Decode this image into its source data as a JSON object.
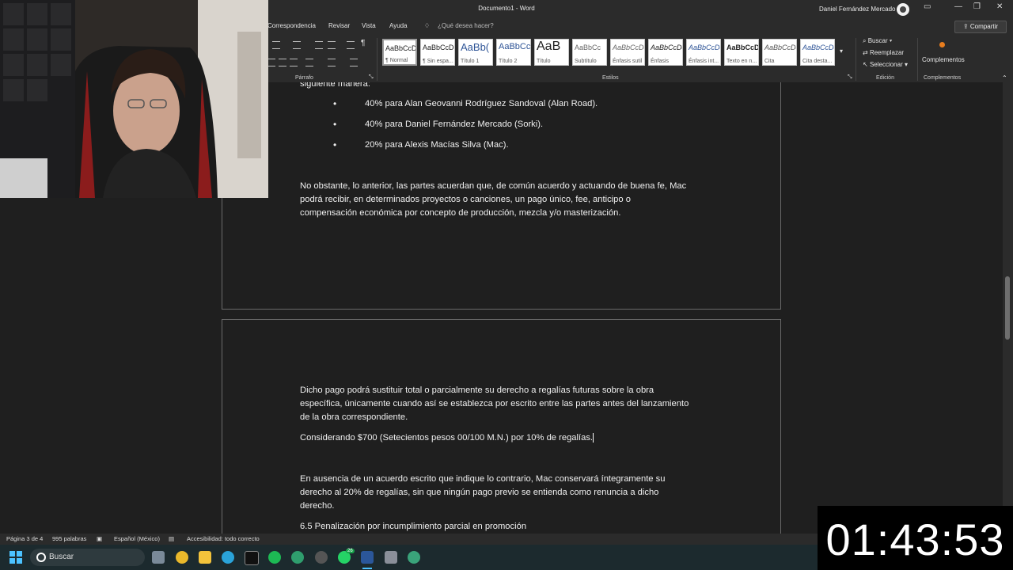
{
  "window": {
    "doc_title": "Documento1 - Word",
    "user_name": "Daniel Fernández Mercado",
    "share_label": "Compartir"
  },
  "tabs": [
    "Correspondencia",
    "Revisar",
    "Vista",
    "Ayuda"
  ],
  "tell_me": "¿Qué desea hacer?",
  "ribbon": {
    "parrafo_label": "Párrafo",
    "estilos_label": "Estilos",
    "edicion_label": "Edición",
    "complementos_group_label": "Complementos",
    "complementos_button": "Complementos",
    "buscar": "Buscar",
    "reemplazar": "Reemplazar",
    "seleccionar": "Seleccionar",
    "styles": [
      {
        "sample": "AaBbCcDc",
        "name": "¶ Normal"
      },
      {
        "sample": "AaBbCcDc",
        "name": "¶ Sin espa..."
      },
      {
        "sample": "AaBb(",
        "name": "Título 1"
      },
      {
        "sample": "AaBbCc",
        "name": "Título 2"
      },
      {
        "sample": "AaB",
        "name": "Título"
      },
      {
        "sample": "AaBbCc",
        "name": "Subtítulo"
      },
      {
        "sample": "AaBbCcDc",
        "name": "Énfasis sutil"
      },
      {
        "sample": "AaBbCcDc",
        "name": "Énfasis"
      },
      {
        "sample": "AaBbCcDc",
        "name": "Énfasis int..."
      },
      {
        "sample": "AaBbCcDc",
        "name": "Texto en n..."
      },
      {
        "sample": "AaBbCcDc",
        "name": "Cita"
      },
      {
        "sample": "AaBbCcDc",
        "name": "Cita desta..."
      }
    ]
  },
  "document": {
    "page1": {
      "cut_line": "siguiente manera:",
      "bullets": [
        "40% para Alan Geovanni Rodríguez Sandoval (Alan Road).",
        "40% para Daniel Fernández Mercado (Sorki).",
        "20% para Alexis Macías Silva (Mac)."
      ],
      "paragraph": [
        "No obstante, lo anterior, las partes acuerdan que, de común acuerdo y actuando de buena fe, Mac",
        "podrá recibir, en determinados proyectos o canciones, un pago único, fee, anticipo o",
        "compensación económica por concepto de producción, mezcla y/o masterización."
      ]
    },
    "page2": {
      "paragraph1": [
        "Dicho pago podrá sustituir total o parcialmente su derecho a regalías futuras sobre la obra",
        "específica, únicamente cuando así se establezca por escrito entre las partes antes del lanzamiento",
        "de la obra correspondiente."
      ],
      "paragraph2": "Considerando $700 (Setecientos pesos 00/100 M.N.) por 10% de regalías.",
      "paragraph3": [
        "En ausencia de un acuerdo escrito que indique lo contrario, Mac conservará íntegramente su",
        "derecho al 20% de regalías, sin que ningún pago previo se entienda como renuncia a dicho",
        "derecho."
      ],
      "heading": "6.5 Penalización por incumplimiento parcial en promoción"
    }
  },
  "status": {
    "page": "Página 3 de 4",
    "words": "995 palabras",
    "language": "Español (México)",
    "accessibility": "Accesibilidad: todo correcto"
  },
  "taskbar": {
    "search_label": "Buscar",
    "whatsapp_badge": "26"
  },
  "timer": "01:43:53"
}
